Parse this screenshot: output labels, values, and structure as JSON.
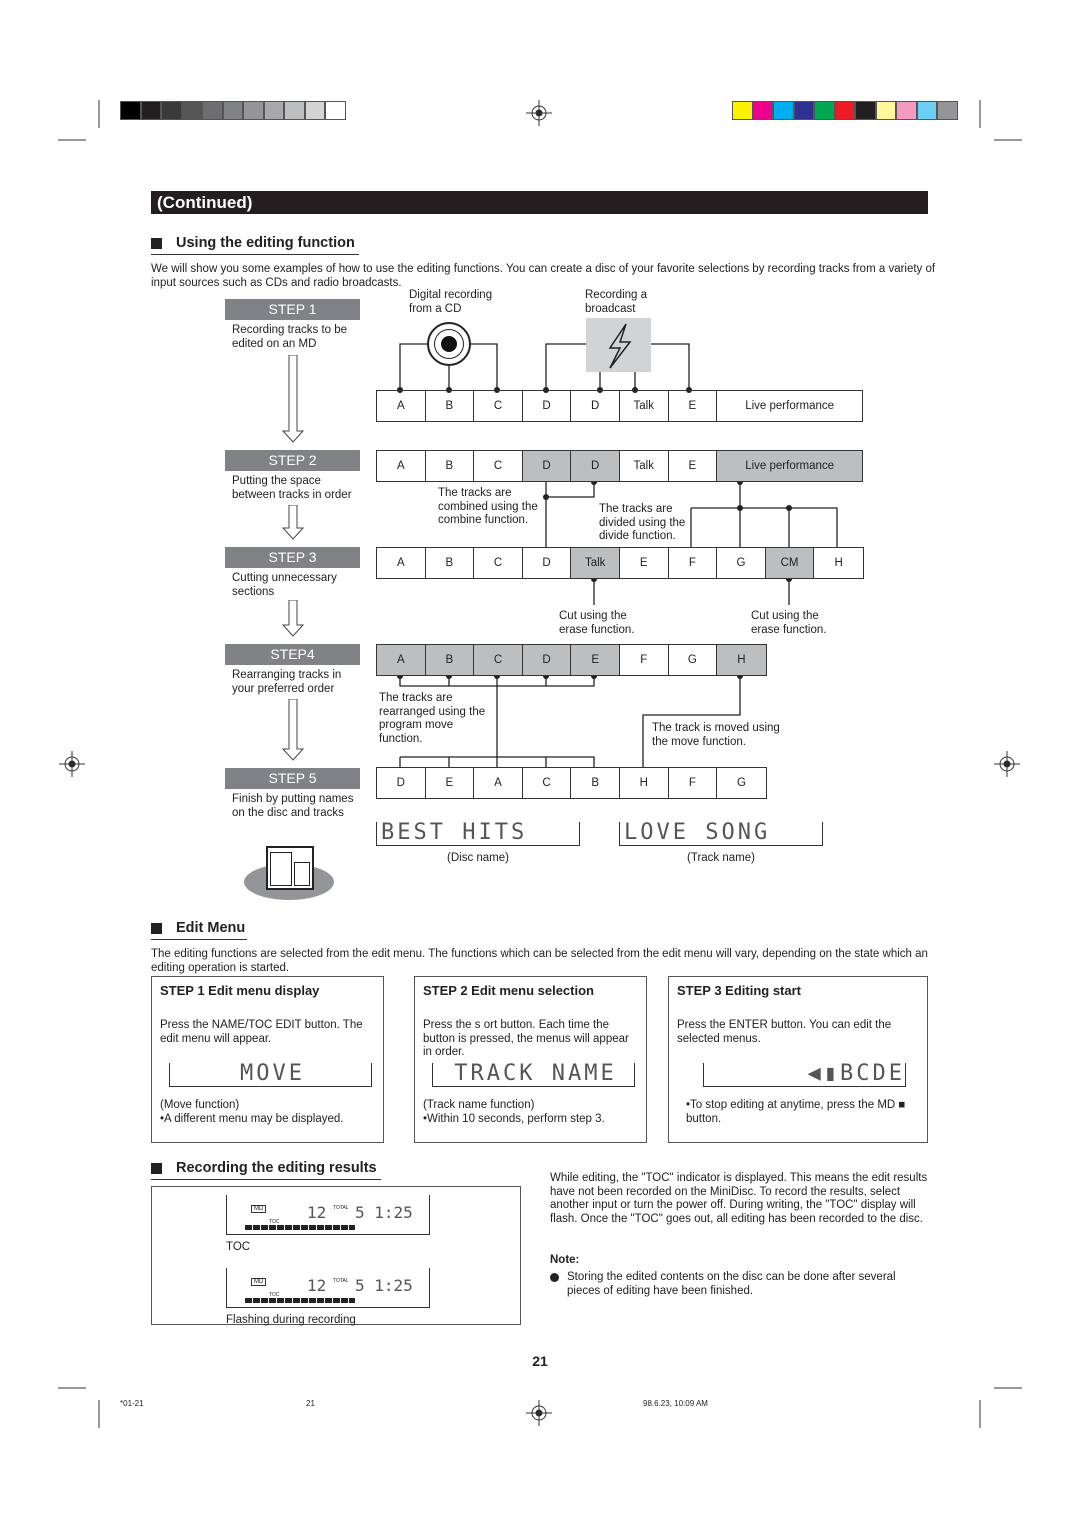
{
  "banner": "(Continued)",
  "section1": {
    "title": "Using the editing function",
    "intro": "We will show you some examples of how to use the editing functions. You can create a disc of your favorite selections by recording tracks from a variety of input sources such as CDs and radio broadcasts."
  },
  "steps": [
    {
      "label": "STEP 1",
      "desc": "Recording tracks to be edited on an MD"
    },
    {
      "label": "STEP 2",
      "desc": "Putting the space between tracks in order"
    },
    {
      "label": "STEP 3",
      "desc": "Cutting unnecessary sections"
    },
    {
      "label": "STEP4",
      "desc": "Rearranging tracks in your preferred order"
    },
    {
      "label": "STEP 5",
      "desc": "Finish by putting names on the disc and tracks"
    }
  ],
  "sources": {
    "cd": "Digital recording from a CD",
    "broadcast": "Recording a broadcast"
  },
  "rows": [
    [
      {
        "t": "A"
      },
      {
        "t": "B"
      },
      {
        "t": "C"
      },
      {
        "t": "D"
      },
      {
        "t": "D"
      },
      {
        "t": "Talk"
      },
      {
        "t": "E"
      },
      {
        "t": "Live performance",
        "wide": true
      }
    ],
    [
      {
        "t": "A"
      },
      {
        "t": "B"
      },
      {
        "t": "C"
      },
      {
        "t": "D",
        "gray": true
      },
      {
        "t": "D",
        "gray": true
      },
      {
        "t": "Talk"
      },
      {
        "t": "E"
      },
      {
        "t": "Live performance",
        "wide": true,
        "gray": true
      }
    ],
    [
      {
        "t": "A"
      },
      {
        "t": "B"
      },
      {
        "t": "C"
      },
      {
        "t": "D"
      },
      {
        "t": "Talk",
        "gray": true
      },
      {
        "t": "E"
      },
      {
        "t": "F"
      },
      {
        "t": "G"
      },
      {
        "t": "CM",
        "gray": true
      },
      {
        "t": "H"
      }
    ],
    [
      {
        "t": "A",
        "gray": true
      },
      {
        "t": "B",
        "gray": true
      },
      {
        "t": "C",
        "gray": true
      },
      {
        "t": "D",
        "gray": true
      },
      {
        "t": "E",
        "gray": true
      },
      {
        "t": "F"
      },
      {
        "t": "G"
      },
      {
        "t": "H",
        "gray": true
      }
    ],
    [
      {
        "t": "D"
      },
      {
        "t": "E"
      },
      {
        "t": "A"
      },
      {
        "t": "C"
      },
      {
        "t": "B"
      },
      {
        "t": "H"
      },
      {
        "t": "F"
      },
      {
        "t": "G"
      }
    ]
  ],
  "notes": {
    "combine": "The tracks are combined using the combine function.",
    "divide": "The tracks are divided using the divide function.",
    "erase1": "Cut using the erase function.",
    "erase2": "Cut using the erase function.",
    "rearranged": "The tracks are rearranged using the program move function.",
    "moved": "The track is moved using the move function."
  },
  "names": {
    "disc_lcd": "BEST HITS",
    "disc_caption": "(Disc name)",
    "track_lcd": "LOVE SONG",
    "track_caption": "(Track name)"
  },
  "edit_menu": {
    "title": "Edit Menu",
    "intro": "The editing functions are selected from the edit menu.  The functions which can be selected from the edit menu will vary, depending on the state which an editing operation is started.",
    "boxes": [
      {
        "title": "STEP 1 Edit menu display",
        "body": "Press the NAME/TOC EDIT button. The edit menu will appear.",
        "lcd": "MOVE",
        "caption": "(Move function)",
        "note": "•A different menu may be displayed."
      },
      {
        "title": "STEP 2 Edit menu selection",
        "body": "Press the s ort   button. Each time the button is pressed, the menus will appear in order.",
        "lcd": "TRACK NAME",
        "caption": "(Track name function)",
        "note": "•Within 10 seconds, perform step 3."
      },
      {
        "title": "STEP 3 Editing start",
        "body": "Press the ENTER button. You can edit the selected menus.",
        "lcd": "◀▮BCDE",
        "caption": "",
        "note": "•To stop editing at anytime, press the MD ■ button."
      }
    ]
  },
  "recording": {
    "title": "Recording the editing results",
    "display1": {
      "md": "MD",
      "track": "12",
      "total": "TOTAL",
      "time": "5 1:25",
      "toc": "TOC",
      "label": "TOC"
    },
    "display2": {
      "md": "MD",
      "track": "12",
      "total": "TOTAL",
      "time": "5 1:25",
      "toc": "TOC",
      "label": "Flashing during recording"
    },
    "text": "While editing, the \"TOC\" indicator is displayed.  This means the edit results have not been recorded on the MiniDisc. To record the results, select another input or turn the power off.  During writing, the \"TOC\" display will flash. Once the \"TOC\" goes out, all editing has been recorded to the disc.",
    "note_title": "Note:",
    "note": "Storing the edited contents on the disc can be done after several pieces of editing have been finished."
  },
  "page_number": "21",
  "footer": {
    "left": "*01-21",
    "mid": "21",
    "right": "98.6.23, 10:09 AM"
  },
  "colors": {
    "gray_scale": [
      "#000000",
      "#231f20",
      "#3a3a3a",
      "#555555",
      "#6d6e71",
      "#808285",
      "#939598",
      "#a7a9ac",
      "#bcbec0",
      "#d1d3d4",
      "#ffffff"
    ],
    "color_bar": [
      "#fff200",
      "#ec008c",
      "#00aeef",
      "#2e3192",
      "#00a651",
      "#ed1c24",
      "#231f20",
      "#fff799",
      "#f49ac1",
      "#6dcff6",
      "#939598"
    ]
  }
}
